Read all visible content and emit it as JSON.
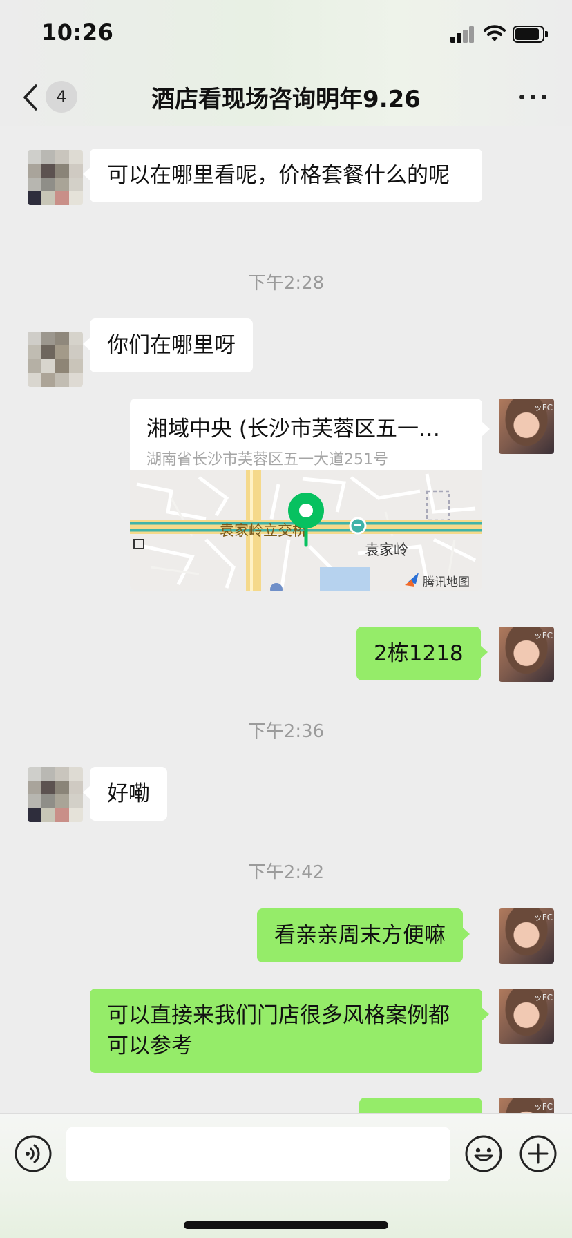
{
  "status_bar": {
    "time": "10:26"
  },
  "header": {
    "unread_count": "4",
    "title": "酒店看现场咨询明年9.26"
  },
  "messages": [
    {
      "side": "left",
      "text": "可以在哪里看呢，价格套餐什么的呢"
    },
    {
      "type": "timestamp",
      "text": "下午2:28"
    },
    {
      "side": "left",
      "text": "你们在哪里呀"
    },
    {
      "side": "right",
      "type": "location",
      "name": "湘域中央 (长沙市芙蓉区五一…",
      "address": "湖南省长沙市芙蓉区五一大道251号",
      "map_labels": {
        "bridge": "袁家岭立交桥",
        "area": "袁家岭",
        "provider": "腾讯地图"
      }
    },
    {
      "side": "right",
      "text": "2栋1218"
    },
    {
      "type": "timestamp",
      "text": "下午2:36"
    },
    {
      "side": "left",
      "text": "好嘞"
    },
    {
      "type": "timestamp",
      "text": "下午2:42"
    },
    {
      "side": "right",
      "text": "看亲亲周末方便嘛"
    },
    {
      "side": "right",
      "text": "可以直接来我们门店很多风格案例都可以参考"
    }
  ],
  "input": {
    "placeholder": ""
  },
  "icons": {
    "back": "chevron-left-icon",
    "more": "more-dots-icon",
    "voice": "voice-icon",
    "emoji": "emoji-icon",
    "plus": "plus-icon",
    "map_pin": "map-pin-icon"
  },
  "colors": {
    "accent_green": "#95ec69",
    "pin_green": "#07c160",
    "chat_background": "#ededed",
    "bubble_white": "#ffffff"
  }
}
